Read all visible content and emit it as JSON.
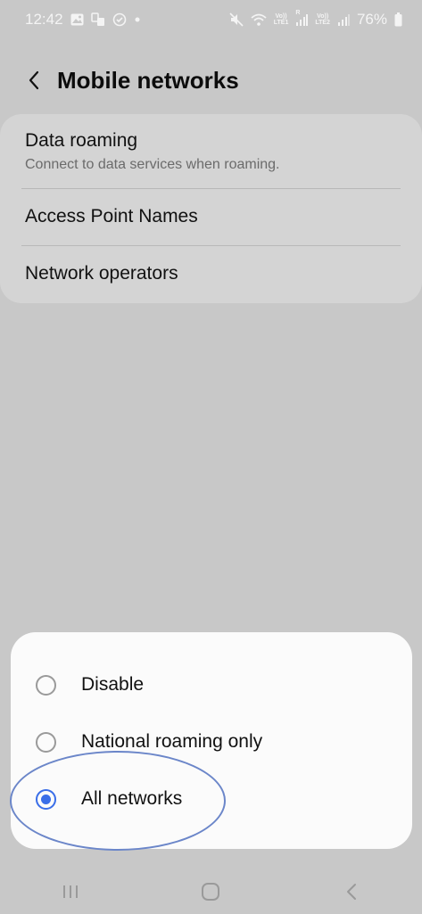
{
  "status_bar": {
    "time": "12:42",
    "battery_percent": "76%",
    "volte1": "Vo))",
    "lte1": "LTE1",
    "volte2": "Vo))",
    "lte2": "LTE2",
    "roaming_indicator": "R",
    "text_color": "#f4f4f4"
  },
  "header": {
    "title": "Mobile networks"
  },
  "settings": {
    "items": [
      {
        "title": "Data roaming",
        "subtitle": "Connect to data services when roaming."
      },
      {
        "title": "Access Point Names"
      },
      {
        "title": "Network operators"
      }
    ]
  },
  "roaming_sheet": {
    "options": [
      {
        "label": "Disable",
        "selected": false
      },
      {
        "label": "National roaming only",
        "selected": false
      },
      {
        "label": "All networks",
        "selected": true
      }
    ],
    "accent_color": "#3a6ee8"
  },
  "colors": {
    "dim_background": "#c8c8c8",
    "card_background": "#d4d4d4",
    "sheet_background": "#fbfbfb",
    "annotation_ring": "#6b86c9"
  },
  "icons": {
    "status_left": [
      "gallery-icon",
      "sim-transfer-icon",
      "secure-folder-icon",
      "notification-dot-icon"
    ],
    "status_right": [
      "mute-icon",
      "wifi-icon",
      "signal-icon",
      "battery-icon"
    ],
    "nav": [
      "recents-icon",
      "home-icon",
      "back-icon"
    ]
  }
}
